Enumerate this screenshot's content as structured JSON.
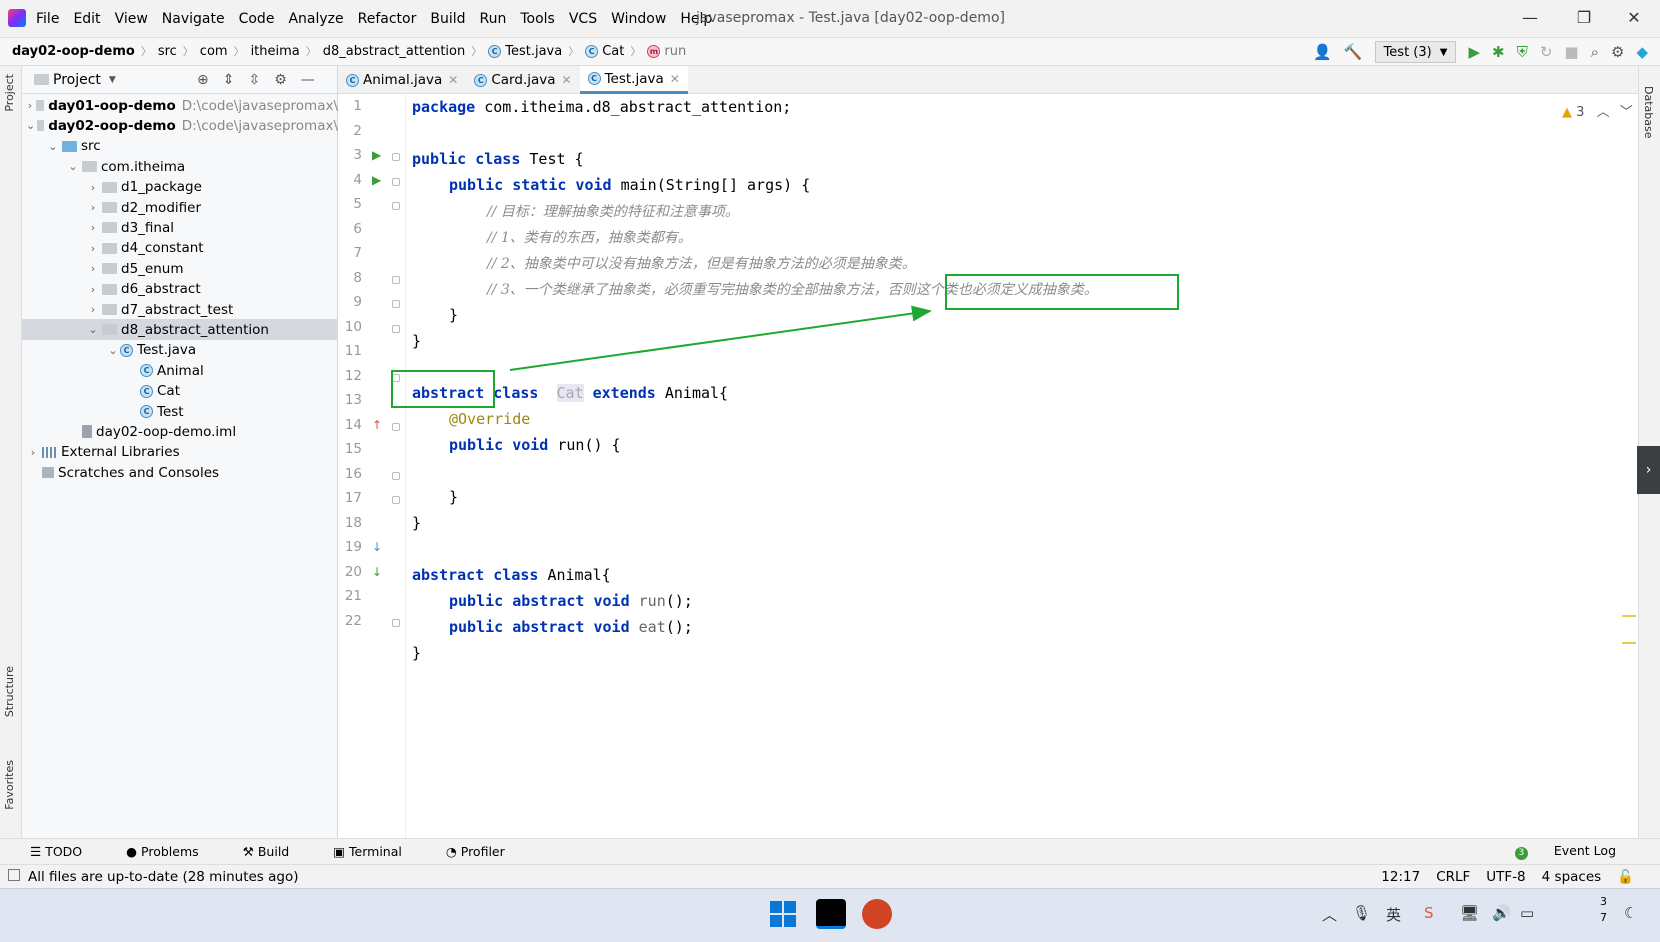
{
  "menu": [
    "File",
    "Edit",
    "View",
    "Navigate",
    "Code",
    "Analyze",
    "Refactor",
    "Build",
    "Run",
    "Tools",
    "VCS",
    "Window",
    "Help"
  ],
  "window_title": "javasepromax - Test.java [day02-oop-demo]",
  "breadcrumbs": [
    "day02-oop-demo",
    "src",
    "com",
    "itheima",
    "d8_abstract_attention",
    "Test.java",
    "Cat",
    "run"
  ],
  "run_config": "Test (3)",
  "project_panel": {
    "title": "Project",
    "tree": [
      {
        "label": "day01-oop-demo",
        "path": "D:\\code\\javasepromax\\",
        "bold": true
      },
      {
        "label": "day02-oop-demo",
        "path": "D:\\code\\javasepromax\\",
        "bold": true
      },
      {
        "label": "src"
      },
      {
        "label": "com.itheima"
      },
      {
        "label": "d1_package"
      },
      {
        "label": "d2_modifier"
      },
      {
        "label": "d3_final"
      },
      {
        "label": "d4_constant"
      },
      {
        "label": "d5_enum"
      },
      {
        "label": "d6_abstract"
      },
      {
        "label": "d7_abstract_test"
      },
      {
        "label": "d8_abstract_attention"
      },
      {
        "label": "Test.java"
      },
      {
        "label": "Animal"
      },
      {
        "label": "Cat"
      },
      {
        "label": "Test"
      },
      {
        "label": "day02-oop-demo.iml"
      },
      {
        "label": "External Libraries"
      },
      {
        "label": "Scratches and Consoles"
      }
    ]
  },
  "tabs": [
    {
      "label": "Animal.java"
    },
    {
      "label": "Card.java"
    },
    {
      "label": "Test.java",
      "active": true
    }
  ],
  "warnings_count": "3",
  "code": {
    "line_numbers": [
      "1",
      "2",
      "3",
      "4",
      "5",
      "6",
      "7",
      "8",
      "9",
      "10",
      "11",
      "12",
      "13",
      "14",
      "15",
      "16",
      "17",
      "18",
      "19",
      "20",
      "21",
      "22"
    ],
    "l1_pkg": "package",
    "l1_rest": " com.itheima.d8_abstract_attention;",
    "l3_kw": "public class",
    "l3_rest": " Test {",
    "l4_kw": "public static void",
    "l4_rest": " main(String[] args) {",
    "l5": "// 目标：理解抽象类的特征和注意事项。",
    "l6": "// 1、类有的东西，抽象类都有。",
    "l7": "// 2、抽象类中可以没有抽象方法，但是有抽象方法的必须是抽象类。",
    "l8a": "// 3、一个类继承了抽象类，必须重写完抽象类的全部抽象方法，",
    "l8b": "否则这个类也必须定义成抽象类。",
    "l9": "}",
    "l10": "}",
    "l12_abstract": "abstract",
    "l12_class": "class",
    "l12_name": "Cat",
    "l12_extends": "extends",
    "l12_rest": " Animal{",
    "l13": "@Override",
    "l14_kw": "public void",
    "l14_rest": " run() {",
    "l16": "}",
    "l17": "}",
    "l19_kw": "abstract class",
    "l19_rest": " Animal{",
    "l20_kw": "public abstract void",
    "l20_name": "run",
    "l20_rest": "();",
    "l21_kw": "public abstract void",
    "l21_name": "eat",
    "l21_rest": "();",
    "l22": "}"
  },
  "tool_windows": [
    "TODO",
    "Problems",
    "Build",
    "Terminal",
    "Profiler"
  ],
  "event_log": "Event Log",
  "status": {
    "message": "All files are up-to-date (28 minutes ago)",
    "position": "12:17",
    "line_sep": "CRLF",
    "encoding": "UTF-8",
    "indent": "4 spaces"
  },
  "side_labels": {
    "project": "Project",
    "structure": "Structure",
    "favorites": "Favorites",
    "database": "Database"
  },
  "taskbar": {
    "clock_top": "3",
    "clock_bottom": "7"
  },
  "colors": {
    "highlight_box": "#1fa831",
    "keyword": "#0033b3",
    "annotation": "#9e880d",
    "comment": "#8c8c8c"
  }
}
